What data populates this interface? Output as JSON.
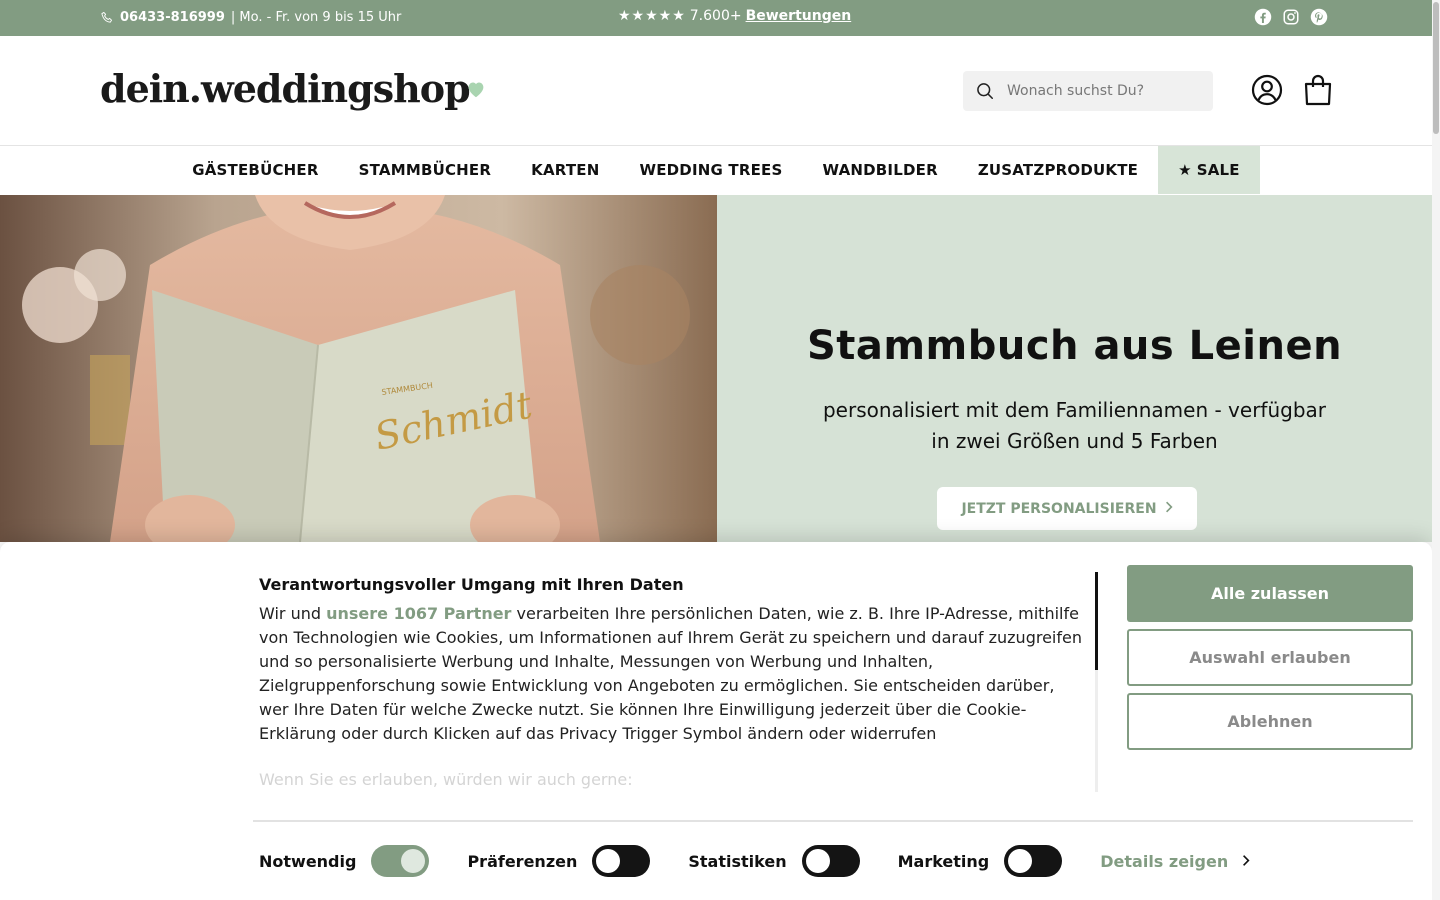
{
  "topbar": {
    "phone": "06433-816999",
    "hours": "| Mo. - Fr. von 9 bis 15 Uhr",
    "stars": "★★★★★",
    "rating_count": "7.600+",
    "reviews_link": "Bewertungen"
  },
  "header": {
    "logo": "dein.weddingshop",
    "search_placeholder": "Wonach suchst Du?"
  },
  "nav": {
    "items": [
      "GÄSTEBÜCHER",
      "STAMMBÜCHER",
      "KARTEN",
      "WEDDING TREES",
      "WANDBILDER",
      "ZUSATZPRODUKTE"
    ],
    "sale_icon": "★",
    "sale_label": "SALE"
  },
  "hero": {
    "image_book_title": "STAMMBUCH",
    "image_book_name": "Schmidt",
    "title": "Stammbuch aus Leinen",
    "subtitle": "personalisiert mit dem Familiennamen - verfügbar in zwei Größen und 5 Farben",
    "cta": "JETZT PERSONALISIEREN"
  },
  "cookie": {
    "title": "Verantwortungsvoller Umgang mit Ihren Daten",
    "text_pre": "Wir und",
    "partners_link": "unsere 1067 Partner",
    "text_post": "verarbeiten Ihre persönlichen Daten, wie z. B. Ihre IP-Adresse, mithilfe von Technologien wie Cookies, um Informationen auf Ihrem Gerät zu speichern und darauf zuzugreifen und so personalisierte Werbung und Inhalte, Messungen von Werbung und Inhalten, Zielgruppenforschung sowie Entwicklung von Angeboten zu ermöglichen. Sie entscheiden darüber, wer Ihre Daten für welche Zwecke nutzt. Sie können Ihre Einwilligung jederzeit über die Cookie-Erklärung oder durch Klicken auf das Privacy Trigger Symbol ändern oder widerrufen",
    "faded_text": "Wenn Sie es erlauben, würden wir auch gerne:",
    "btn_allow_all": "Alle zulassen",
    "btn_allow_selection": "Auswahl erlauben",
    "btn_decline": "Ablehnen",
    "toggles": [
      {
        "label": "Notwendig",
        "state": "on"
      },
      {
        "label": "Präferenzen",
        "state": "off"
      },
      {
        "label": "Statistiken",
        "state": "off"
      },
      {
        "label": "Marketing",
        "state": "off"
      }
    ],
    "details_link": "Details zeigen"
  },
  "colors": {
    "brand_green": "#829c82",
    "hero_bg": "#d6e2d6",
    "sale_bg": "#d7e4d7"
  }
}
